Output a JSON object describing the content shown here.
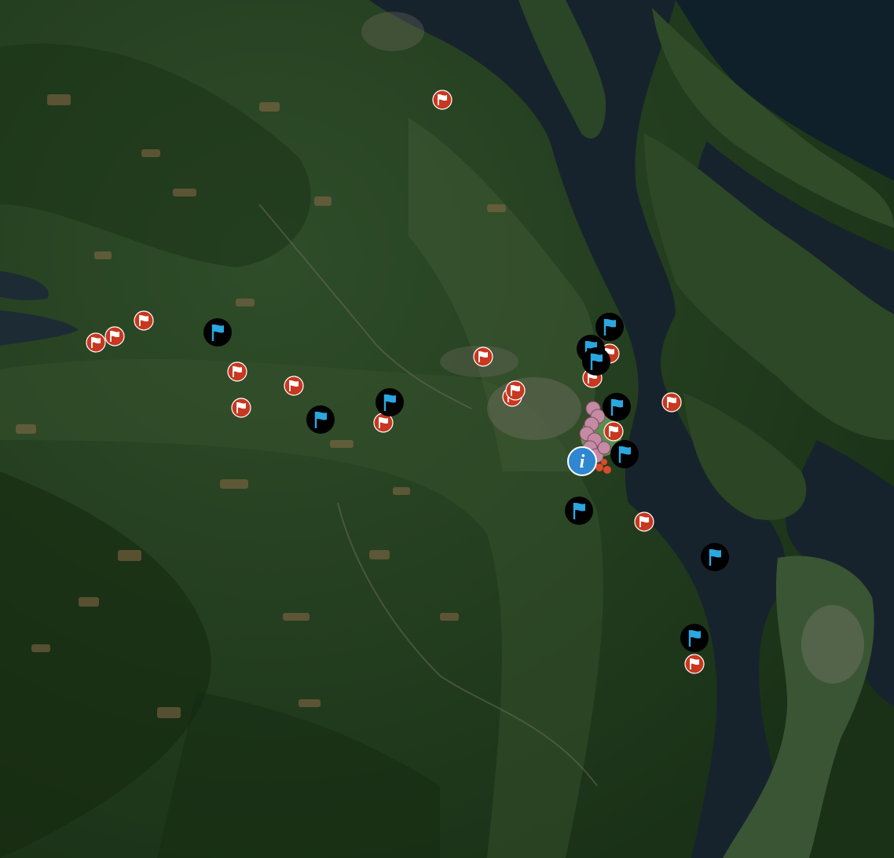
{
  "map": {
    "type": "satellite",
    "colors": {
      "forest_dark": "#1c3519",
      "forest": "#2c4a26",
      "forest_light": "#3c5a30",
      "clearcut": "#8a6a48",
      "water": "#17232c",
      "water_deep": "#10202a",
      "urban": "#7c7a6e"
    }
  },
  "legend_colors": {
    "red_flag_marker": "#c8371f",
    "blue_flag_marker_bg": "#000000",
    "blue_flag": "#2aa7e0",
    "info_marker": "#2f87cf",
    "cluster_pink": "#c58aa4"
  },
  "markers": {
    "red_flags": [
      {
        "icon": "red-flag-icon"
      },
      {
        "icon": "red-flag-icon"
      },
      {
        "icon": "red-flag-icon"
      },
      {
        "icon": "red-flag-icon"
      },
      {
        "icon": "red-flag-icon"
      },
      {
        "icon": "red-flag-icon"
      },
      {
        "icon": "red-flag-icon"
      },
      {
        "icon": "red-flag-icon"
      },
      {
        "icon": "red-flag-icon"
      },
      {
        "icon": "red-flag-icon"
      },
      {
        "icon": "red-flag-icon"
      },
      {
        "icon": "red-flag-icon"
      },
      {
        "icon": "red-flag-icon"
      },
      {
        "icon": "red-flag-icon"
      },
      {
        "icon": "red-flag-icon"
      },
      {
        "icon": "red-flag-icon"
      },
      {
        "icon": "red-flag-icon"
      }
    ],
    "blue_flags": [
      {
        "icon": "blue-flag-icon"
      },
      {
        "icon": "blue-flag-icon"
      },
      {
        "icon": "blue-flag-icon"
      },
      {
        "icon": "blue-flag-icon"
      },
      {
        "icon": "blue-flag-icon"
      },
      {
        "icon": "blue-flag-icon"
      },
      {
        "icon": "blue-flag-icon"
      },
      {
        "icon": "blue-flag-icon"
      },
      {
        "icon": "blue-flag-icon"
      },
      {
        "icon": "blue-flag-icon"
      },
      {
        "icon": "blue-flag-icon"
      }
    ],
    "info": {
      "icon": "info-icon",
      "glyph": "i"
    },
    "cluster": {
      "icon": "marker-cluster-icon"
    }
  }
}
